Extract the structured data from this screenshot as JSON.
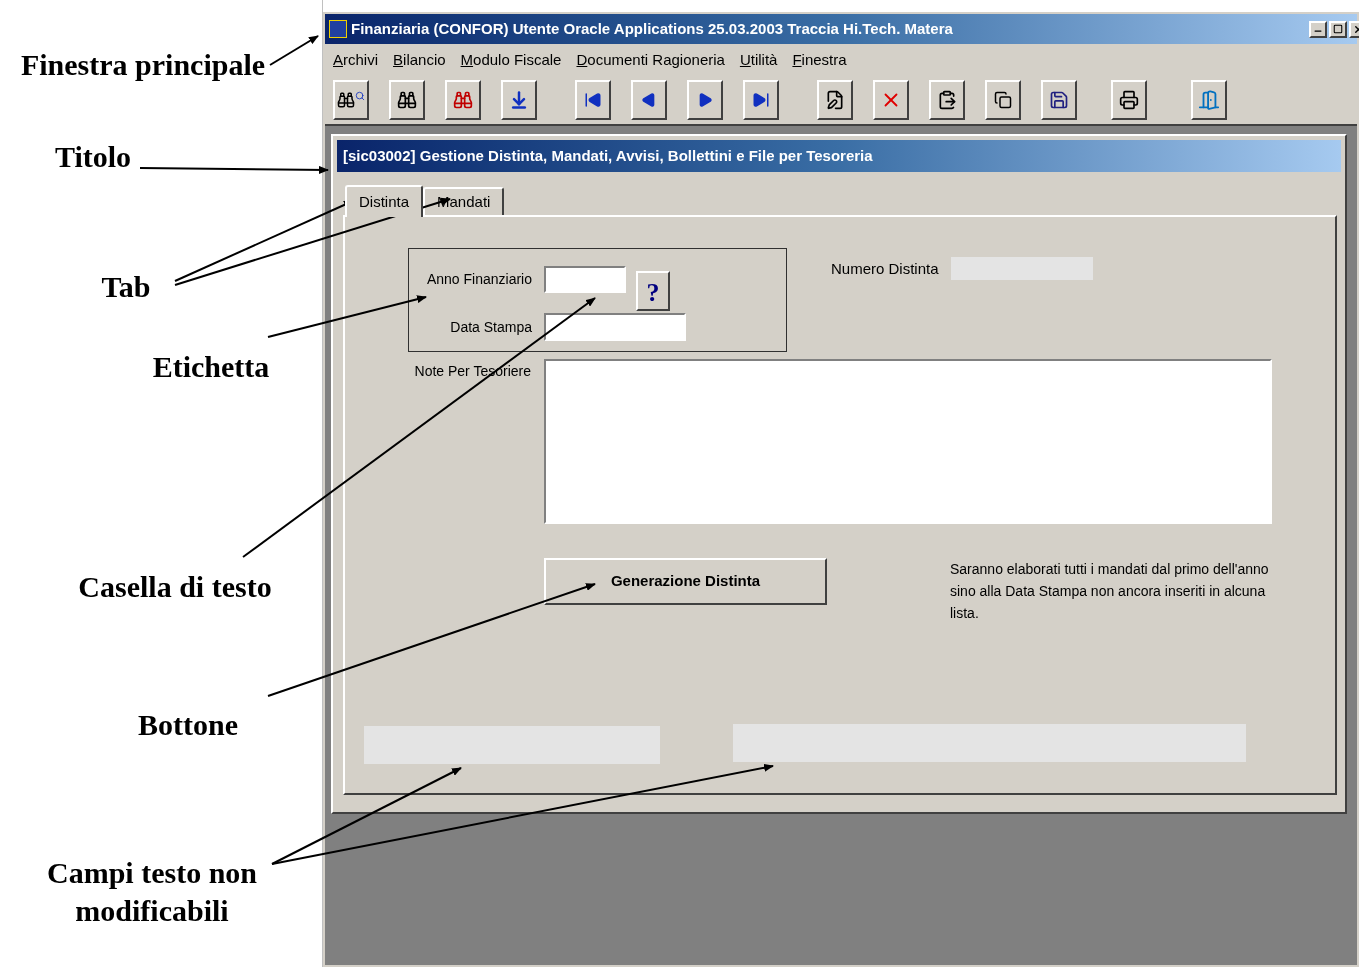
{
  "annotations": [
    {
      "text": "Finestra principale"
    },
    {
      "text": "Titolo"
    },
    {
      "text": "Tab"
    },
    {
      "text": "Etichetta"
    },
    {
      "text": "Casella di testo"
    },
    {
      "text": "Bottone"
    },
    {
      "text": "Campi testo non modificabili"
    }
  ],
  "window": {
    "title": "Finanziaria (CONFOR) Utente Oracle Applications 25.03.2003 Traccia Hi.Tech. Matera",
    "menu": [
      "Archivi",
      "Bilancio",
      "Modulo Fiscale",
      "Documenti Ragioneria",
      "Utilità",
      "Finestra"
    ]
  },
  "form": {
    "title": "[sic03002] Gestione Distinta, Mandati, Avvisi, Bollettini e File per Tesoreria",
    "tabs": [
      {
        "label": "Distinta",
        "selected": true
      },
      {
        "label": "Mandati",
        "selected": false
      }
    ],
    "anno_label": "Anno Finanziario",
    "data_label": "Data Stampa",
    "help_button": "?",
    "numero_label": "Numero Distinta",
    "note_label": "Note Per Tesoriere",
    "generate_button": "Generazione Distinta",
    "info_text": "Saranno elaborati tutti i mandati dal primo dell'anno sino alla Data Stampa non ancora inseriti in alcuna lista."
  }
}
